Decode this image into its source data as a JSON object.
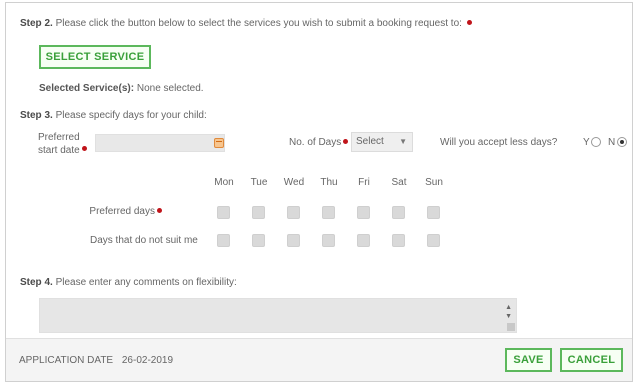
{
  "step2": {
    "label": "Step 2.",
    "text": "Please click the button below to select the services you wish to submit a booking request to:",
    "button": "SELECT SERVICE",
    "selected_label": "Selected Service(s):",
    "selected_value": "None selected."
  },
  "step3": {
    "label": "Step 3.",
    "text": "Please specify days for your child:",
    "start_date_label_1": "Preferred",
    "start_date_label_2": "start date",
    "start_date_value": "",
    "days_label": "No. of Days",
    "days_select": "Select",
    "accept_less_label": "Will you accept less days?",
    "yes": "Y",
    "no": "N",
    "selected_option": "N",
    "day_names": [
      "Mon",
      "Tue",
      "Wed",
      "Thu",
      "Fri",
      "Sat",
      "Sun"
    ],
    "rows": [
      {
        "label": "Preferred days",
        "required": true
      },
      {
        "label": "Days that do not suit me",
        "required": false
      }
    ]
  },
  "step4": {
    "label": "Step 4.",
    "text": "Please enter any comments on flexibility:",
    "comment_value": ""
  },
  "footer": {
    "app_date_label": "APPLICATION DATE",
    "app_date_value": "26-02-2019",
    "save": "SAVE",
    "cancel": "CANCEL"
  },
  "colors": {
    "required_dot": "#c0141a",
    "button_green": "#5cb85c",
    "calendar_orange": "#e08a3c"
  }
}
